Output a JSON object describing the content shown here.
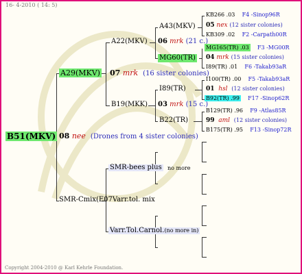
{
  "header": {
    "date": "16- 4-2010 ( 14: 5)"
  },
  "footer": {
    "copyright": "Copyright 2004-2010 @ Karl Kehrle Foundation."
  },
  "root": {
    "label": "B51(MKV)",
    "gen": "08",
    "mark": "nee",
    "note": "(Drones from 4 sister colonies)"
  },
  "mother": {
    "label": "A29(MKV)",
    "gen": "07",
    "mark": "mrk",
    "note": "(16 sister colonies)"
  },
  "g1a": {
    "label": "A22(MKV)",
    "gen": "06",
    "mark": "mrk",
    "note": "(21 c.)"
  },
  "g1b": {
    "label": "B19(MKK)",
    "gen": "03",
    "mark": "mrk",
    "note": "(15 c.)"
  },
  "a43": {
    "label": "A43(MKV)",
    "gen": "05",
    "mark": "nex",
    "note": "(12 sister colonies)"
  },
  "mg60": {
    "label": "MG60(TR)",
    "gen": "04",
    "mark": "mrk",
    "note": "(15 sister colonies)"
  },
  "i89": {
    "label": "I89(TR)",
    "gen": "01",
    "mark": "hsl",
    "note": "(12 sister colonies)"
  },
  "b22": {
    "label": "B22(TR)",
    "gen": "99",
    "mark": "aml",
    "note": "(12 sister colonies)"
  },
  "right": [
    {
      "label": "KB266 .03",
      "link": "F4 -Sinop96R"
    },
    {
      "label": "KB309 .02",
      "link": "F2 -Carpath00R"
    },
    {
      "label": "MG165(TR) .03",
      "link": "F3 -MG00R"
    },
    {
      "label": "I89(TR) .01",
      "link": "F6 -Takab93aR"
    },
    {
      "label": "I100(TR) .00",
      "link": "F5 -Takab93aR"
    },
    {
      "label": "B92(TR) .99",
      "link": "F17 -Sinop62R"
    },
    {
      "label": "B129(TR) .96",
      "link": "F9 -Atlas85R"
    },
    {
      "label": "B175(TR) .95",
      "link": "F13 -Sinop72R"
    }
  ],
  "smr": {
    "main_label": "SMR-Cmix(E07",
    "main_suffix": "Varr.tol. mix",
    "bees_label": "SMR-bees plus",
    "bees_note": "no more",
    "carnol_label": "Varr.Tol.Carnol.",
    "carnol_note": "(no more in)"
  }
}
